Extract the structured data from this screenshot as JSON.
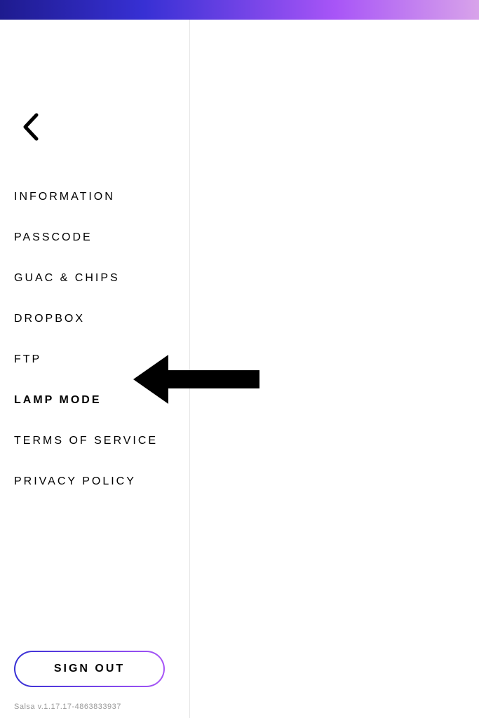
{
  "menu": {
    "items": [
      {
        "label": "INFORMATION",
        "highlighted": false
      },
      {
        "label": "PASSCODE",
        "highlighted": false
      },
      {
        "label": "GUAC & CHIPS",
        "highlighted": false
      },
      {
        "label": "DROPBOX",
        "highlighted": false
      },
      {
        "label": "FTP",
        "highlighted": false
      },
      {
        "label": "LAMP MODE",
        "highlighted": true
      },
      {
        "label": "TERMS OF SERVICE",
        "highlighted": false
      },
      {
        "label": "PRIVACY POLICY",
        "highlighted": false
      }
    ]
  },
  "signout": {
    "label": "SIGN OUT"
  },
  "version": {
    "text": "Salsa v.1.17.17-4863833937"
  }
}
